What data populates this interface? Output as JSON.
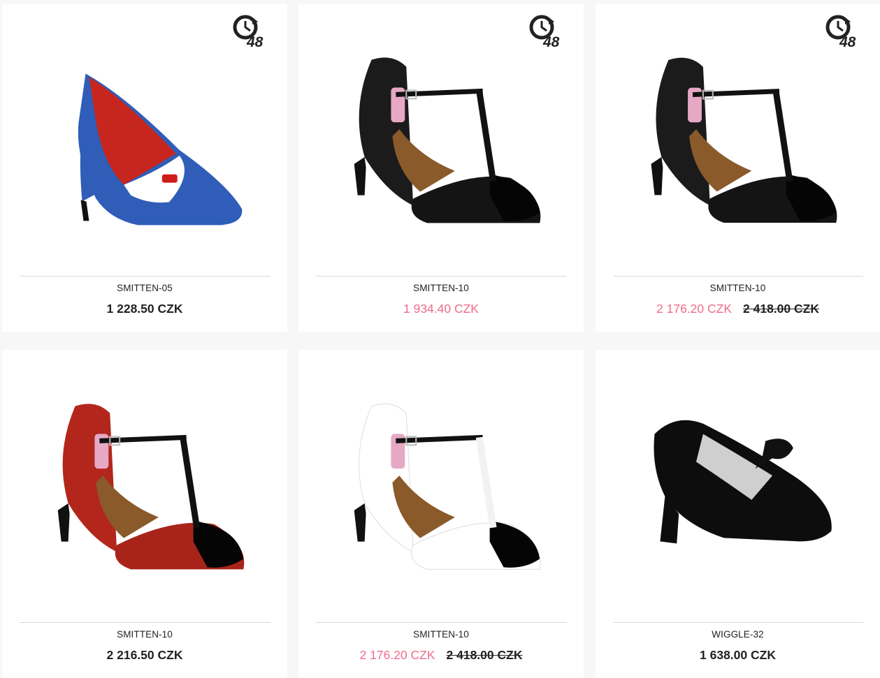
{
  "badge": {
    "text": "48",
    "icon": "clock-48h-icon"
  },
  "colors": {
    "sale": "#f06b8e",
    "text": "#222222"
  },
  "products": [
    {
      "name": "SMITTEN-05",
      "price": "1 228.50 CZK",
      "old_price": "",
      "sale": false,
      "badge": true,
      "image": "blue-pump-shoe"
    },
    {
      "name": "SMITTEN-10",
      "price": "1 934.40 CZK",
      "old_price": "",
      "sale": true,
      "badge": true,
      "image": "black-tstrap-shoe"
    },
    {
      "name": "SMITTEN-10",
      "price": "2 176.20 CZK",
      "old_price": "2 418.00 CZK",
      "sale": true,
      "badge": true,
      "image": "black-tstrap-shoe"
    },
    {
      "name": "SMITTEN-10",
      "price": "2 216.50 CZK",
      "old_price": "",
      "sale": false,
      "badge": false,
      "image": "red-tstrap-shoe"
    },
    {
      "name": "SMITTEN-10",
      "price": "2 176.20 CZK",
      "old_price": "2 418.00 CZK",
      "sale": true,
      "badge": false,
      "image": "white-tstrap-shoe"
    },
    {
      "name": "WIGGLE-32",
      "price": "1 638.00 CZK",
      "old_price": "",
      "sale": false,
      "badge": false,
      "image": "black-oxford-heel"
    }
  ]
}
